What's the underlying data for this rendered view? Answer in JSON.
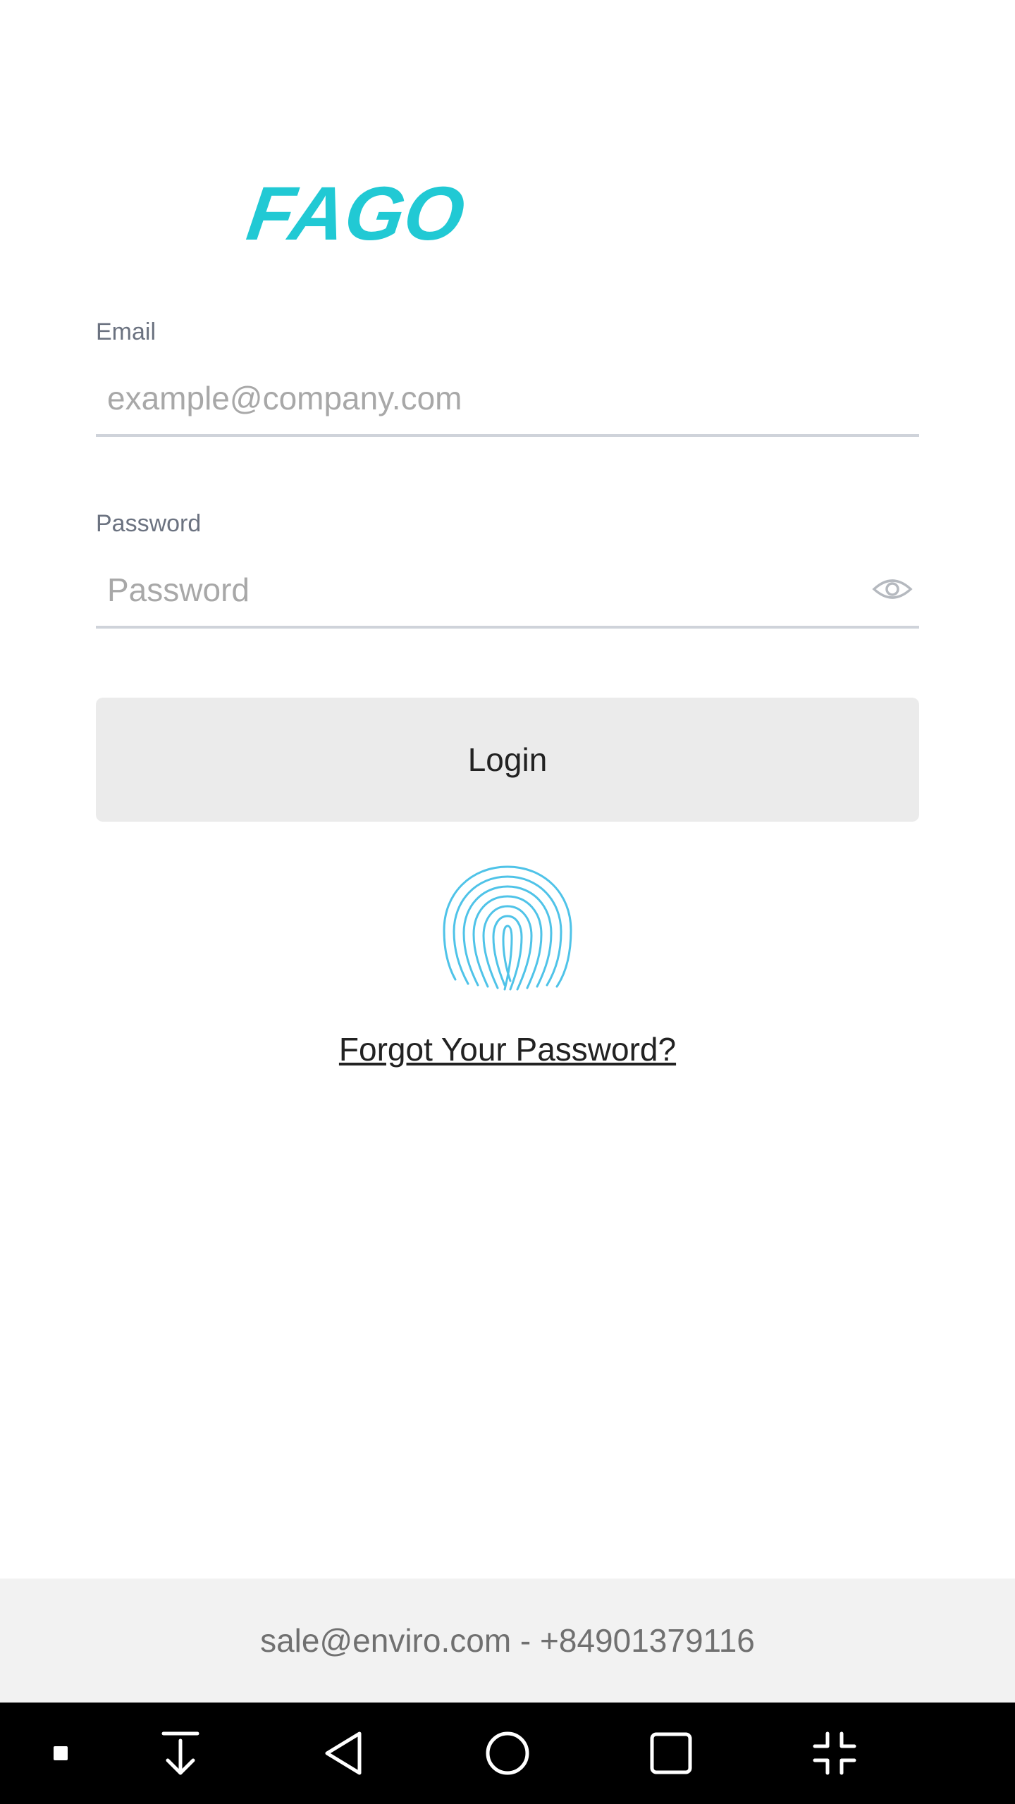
{
  "logo": {
    "text": "FAGO",
    "color": "#21c9d4"
  },
  "form": {
    "email": {
      "label": "Email",
      "placeholder": "example@company.com",
      "value": ""
    },
    "password": {
      "label": "Password",
      "placeholder": "Password",
      "value": ""
    },
    "login_label": "Login",
    "forgot_label": "Forgot Your Password?"
  },
  "footer": {
    "contact": "sale@enviro.com - +84901379116"
  },
  "icons": {
    "eye": "eye-icon",
    "fingerprint": "fingerprint-icon",
    "nav": [
      "dot-icon",
      "download-icon",
      "back-icon",
      "home-icon",
      "recents-icon",
      "collapse-icon"
    ]
  },
  "colors": {
    "accent": "#21c9d4",
    "fingerprint": "#4fc3e8",
    "button_bg": "#ebebeb",
    "footer_bg": "#f2f2f2",
    "navbar_bg": "#000000"
  }
}
